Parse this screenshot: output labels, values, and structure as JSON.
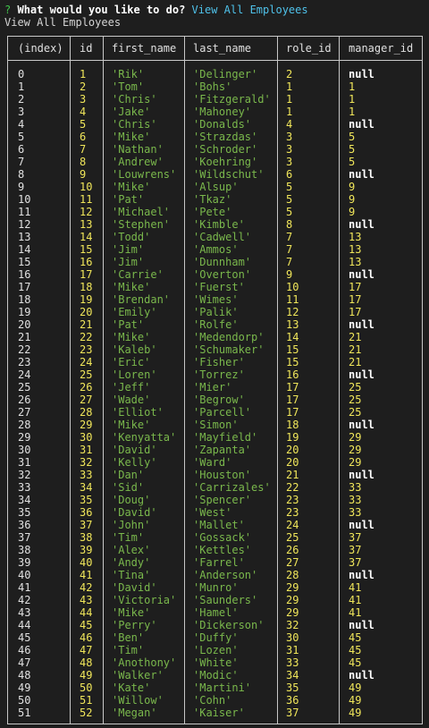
{
  "prompt": {
    "marker": "?",
    "question": "What would you like to do?",
    "answer": "View All Employees"
  },
  "echo": "View All Employees",
  "table": {
    "headers": [
      "(index)",
      "id",
      "first_name",
      "last_name",
      "role_id",
      "manager_id"
    ],
    "rows": [
      [
        "0",
        "1",
        "'Rik'",
        "'Delinger'",
        "2",
        "null"
      ],
      [
        "1",
        "2",
        "'Tom'",
        "'Bohs'",
        "1",
        "1"
      ],
      [
        "2",
        "3",
        "'Chris'",
        "'Fitzgerald'",
        "1",
        "1"
      ],
      [
        "3",
        "4",
        "'Jake'",
        "'Mahoney'",
        "1",
        "1"
      ],
      [
        "4",
        "5",
        "'Chris'",
        "'Donalds'",
        "4",
        "null"
      ],
      [
        "5",
        "6",
        "'Mike'",
        "'Strazdas'",
        "3",
        "5"
      ],
      [
        "6",
        "7",
        "'Nathan'",
        "'Schroder'",
        "3",
        "5"
      ],
      [
        "7",
        "8",
        "'Andrew'",
        "'Koehring'",
        "3",
        "5"
      ],
      [
        "8",
        "9",
        "'Louwrens'",
        "'Wildschut'",
        "6",
        "null"
      ],
      [
        "9",
        "10",
        "'Mike'",
        "'Alsup'",
        "5",
        "9"
      ],
      [
        "10",
        "11",
        "'Pat'",
        "'Tkaz'",
        "5",
        "9"
      ],
      [
        "11",
        "12",
        "'Michael'",
        "'Pete'",
        "5",
        "9"
      ],
      [
        "12",
        "13",
        "'Stephen'",
        "'Kimble'",
        "8",
        "null"
      ],
      [
        "13",
        "14",
        "'Todd'",
        "'Cadwell'",
        "7",
        "13"
      ],
      [
        "14",
        "15",
        "'Jim'",
        "'Ammos'",
        "7",
        "13"
      ],
      [
        "15",
        "16",
        "'Jim'",
        "'Dunnham'",
        "7",
        "13"
      ],
      [
        "16",
        "17",
        "'Carrie'",
        "'Overton'",
        "9",
        "null"
      ],
      [
        "17",
        "18",
        "'Mike'",
        "'Fuerst'",
        "10",
        "17"
      ],
      [
        "18",
        "19",
        "'Brendan'",
        "'Wimes'",
        "11",
        "17"
      ],
      [
        "19",
        "20",
        "'Emily'",
        "'Palik'",
        "12",
        "17"
      ],
      [
        "20",
        "21",
        "'Pat'",
        "'Rolfe'",
        "13",
        "null"
      ],
      [
        "21",
        "22",
        "'Mike'",
        "'Medendorp'",
        "14",
        "21"
      ],
      [
        "22",
        "23",
        "'Kaleb'",
        "'Schumaker'",
        "15",
        "21"
      ],
      [
        "23",
        "24",
        "'Eric'",
        "'Fisher'",
        "15",
        "21"
      ],
      [
        "24",
        "25",
        "'Loren'",
        "'Torrez'",
        "16",
        "null"
      ],
      [
        "25",
        "26",
        "'Jeff'",
        "'Mier'",
        "17",
        "25"
      ],
      [
        "26",
        "27",
        "'Wade'",
        "'Begrow'",
        "17",
        "25"
      ],
      [
        "27",
        "28",
        "'Elliot'",
        "'Parcell'",
        "17",
        "25"
      ],
      [
        "28",
        "29",
        "'Mike'",
        "'Simon'",
        "18",
        "null"
      ],
      [
        "29",
        "30",
        "'Kenyatta'",
        "'Mayfield'",
        "19",
        "29"
      ],
      [
        "30",
        "31",
        "'David'",
        "'Zapanta'",
        "20",
        "29"
      ],
      [
        "31",
        "32",
        "'Kelly'",
        "'Ward'",
        "20",
        "29"
      ],
      [
        "32",
        "33",
        "'Dan'",
        "'Houston'",
        "21",
        "null"
      ],
      [
        "33",
        "34",
        "'Sid'",
        "'Carrizales'",
        "22",
        "33"
      ],
      [
        "34",
        "35",
        "'Doug'",
        "'Spencer'",
        "23",
        "33"
      ],
      [
        "35",
        "36",
        "'David'",
        "'West'",
        "23",
        "33"
      ],
      [
        "36",
        "37",
        "'John'",
        "'Mallet'",
        "24",
        "null"
      ],
      [
        "37",
        "38",
        "'Tim'",
        "'Gossack'",
        "25",
        "37"
      ],
      [
        "38",
        "39",
        "'Alex'",
        "'Kettles'",
        "26",
        "37"
      ],
      [
        "39",
        "40",
        "'Andy'",
        "'Farrel'",
        "27",
        "37"
      ],
      [
        "40",
        "41",
        "'Tina'",
        "'Anderson'",
        "28",
        "null"
      ],
      [
        "41",
        "42",
        "'David'",
        "'Munro'",
        "29",
        "41"
      ],
      [
        "42",
        "43",
        "'Victoria'",
        "'Saunders'",
        "29",
        "41"
      ],
      [
        "43",
        "44",
        "'Mike'",
        "'Hamel'",
        "29",
        "41"
      ],
      [
        "44",
        "45",
        "'Perry'",
        "'Dickerson'",
        "32",
        "null"
      ],
      [
        "45",
        "46",
        "'Ben'",
        "'Duffy'",
        "30",
        "45"
      ],
      [
        "46",
        "47",
        "'Tim'",
        "'Lozen'",
        "31",
        "45"
      ],
      [
        "47",
        "48",
        "'Anothony'",
        "'White'",
        "33",
        "45"
      ],
      [
        "48",
        "49",
        "'Walker'",
        "'Modic'",
        "34",
        "null"
      ],
      [
        "49",
        "50",
        "'Kate'",
        "'Martini'",
        "35",
        "49"
      ],
      [
        "50",
        "51",
        "'Willow'",
        "'Cohn'",
        "36",
        "49"
      ],
      [
        "51",
        "52",
        "'Megan'",
        "'Kaiser'",
        "37",
        "49"
      ]
    ]
  }
}
